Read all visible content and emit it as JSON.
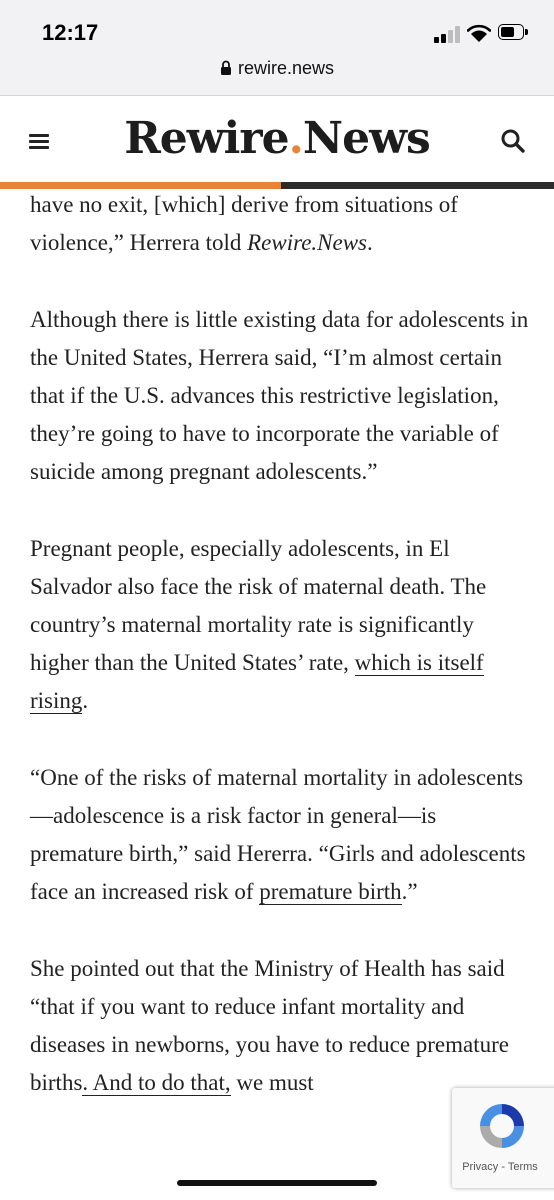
{
  "status_bar": {
    "time": "12:17",
    "url": "rewire.news"
  },
  "header": {
    "logo_primary": "Rewire",
    "logo_dot": ".",
    "logo_secondary": "News",
    "accent_color": "#e8843a",
    "menu_icon": "hamburger-menu-icon",
    "search_icon": "search-icon"
  },
  "article": {
    "p1": {
      "text": "have no exit, [which] derive from situations of violence,” Herrera told ",
      "em": "Rewire.News",
      "end": "."
    },
    "p2": "Although there is little existing data for adolescents in the United States, Herrera said, “I’m almost certain that if the U.S. advances this restrictive legislation, they’re going to have to incorporate the variable of suicide among pregnant adolescents.”",
    "p3": {
      "text": "Pregnant people, especially adolescents, in El Salvador also face the risk of maternal death. The country’s maternal mortality rate is significantly higher than the United States’ rate, ",
      "link": "which is itself rising",
      "end": "."
    },
    "p4": {
      "text": "“One of the risks of maternal mortality in adolescents—adolescence is a risk factor in general—is premature birth,” said Hererra. “Girls and adolescents face an increased risk of ",
      "link": "premature birth",
      "end": ".”"
    },
    "p5": {
      "text": "She pointed out that the Ministry of Health has said “that if you want to reduce infant mortality and diseases in newborns, you have to reduce premature births",
      "link": ". And to do that,",
      "end": " we must"
    }
  },
  "recaptcha": {
    "links": "Privacy - Terms"
  }
}
